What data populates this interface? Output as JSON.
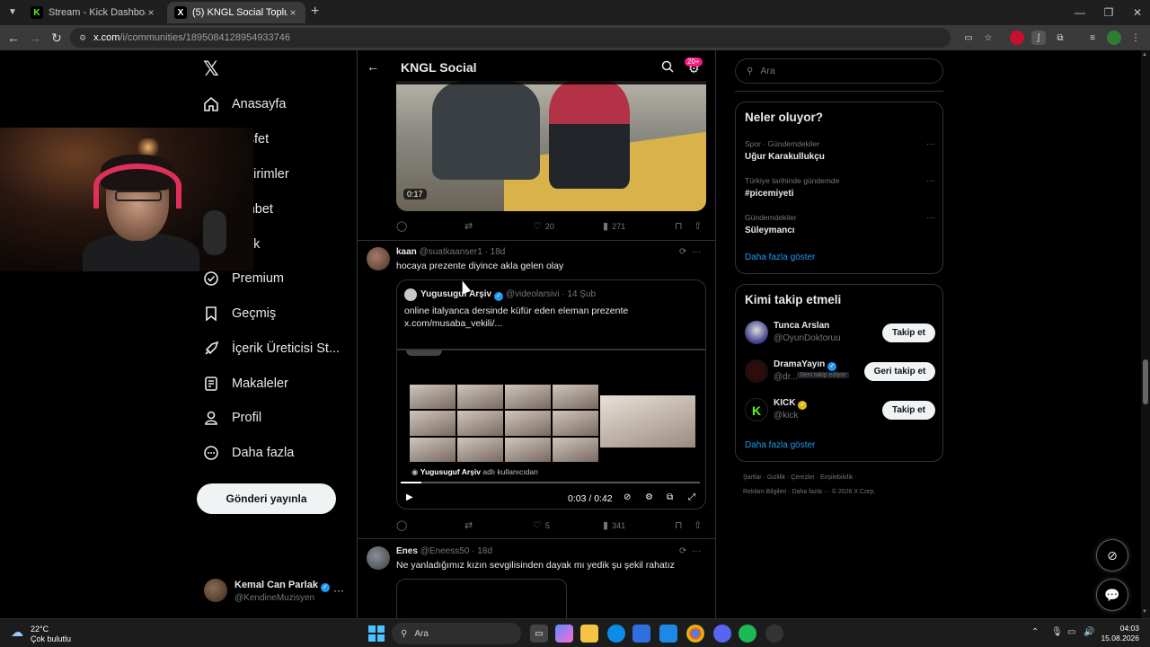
{
  "browser": {
    "tabs": [
      {
        "label": "Stream - Kick Dashboard",
        "active": false
      },
      {
        "label": "(5) KNGL Social Topluluk / X",
        "active": true
      }
    ],
    "url_host": "x.com",
    "url_path": "/i/communities/1895084128954933746"
  },
  "nav": {
    "items": [
      {
        "label": "Anasayfa",
        "icon": "home-icon"
      },
      {
        "label": "Keşfet",
        "icon": "search-icon"
      },
      {
        "label": "Bildirimler",
        "icon": "bell-icon"
      },
      {
        "label": "Sohbet",
        "icon": "chat-icon"
      },
      {
        "label": "Grok",
        "icon": "grok-icon"
      },
      {
        "label": "Premium",
        "icon": "premium-icon"
      },
      {
        "label": "Geçmiş",
        "icon": "bookmark-icon"
      },
      {
        "label": "İçerik Üreticisi St...",
        "icon": "rocket-icon"
      },
      {
        "label": "Makaleler",
        "icon": "article-icon"
      },
      {
        "label": "Profil",
        "icon": "person-icon"
      },
      {
        "label": "Daha fazla",
        "icon": "more-circle-icon"
      }
    ],
    "post_button": "Gönderi yayınla",
    "account": {
      "name": "Kemal Can Parlak",
      "handle": "@KendineMuzisyen"
    }
  },
  "header": {
    "title": "KNGL Social",
    "badge": "20+"
  },
  "feed": {
    "tweet1": {
      "duration": "0:17",
      "replies": "",
      "retweets": "",
      "likes": "20",
      "views": "271"
    },
    "tweet2": {
      "name": "kaan",
      "handle": "@suatkaanser1",
      "time": "· 18d",
      "text": "hocaya prezente diyince akla gelen olay",
      "quote": {
        "name": "Yugusuguf Arşiv",
        "handle": "@videolarsivi",
        "time": "· 14 Şub",
        "text_line1": "online italyanca dersinde küfür eden eleman prezente",
        "text_line2": "x.com/musaba_vekili/...",
        "credit_name": "Yugusuguf Arşiv",
        "credit_suffix": "adlı kullanıcıdan",
        "time_display": "0:03 / 0:42",
        "progress": 0.07
      },
      "likes": "5",
      "views": "341"
    },
    "tweet3": {
      "name": "Enes",
      "handle": "@Eneess50",
      "time": "· 18d",
      "text": "Ne yanladığımız kızın sevgilisinden dayak mı yedik şu şekil rahatız"
    }
  },
  "right": {
    "search_placeholder": "Ara",
    "trends_title": "Neler oluyor?",
    "trends": [
      {
        "context": "Spor · Gündemdekiler",
        "title": "Uğur Karakullukçu"
      },
      {
        "context": "Türkiye tarihinde gündemde",
        "title": "#picemiyeti"
      },
      {
        "context": "Gündemdekiler",
        "title": "Süleymancı"
      }
    ],
    "trends_more": "Daha fazla göster",
    "who_title": "Kimi takip etmeli",
    "who": [
      {
        "name": "Tunca Arslan",
        "handle": "@OyunDoktoruu",
        "button": "Takip et",
        "verified": ""
      },
      {
        "name": "DramaYayın",
        "handle": "@dr...",
        "tag": "Seni takip ediyor",
        "button": "Geri takip et",
        "verified": "blue"
      },
      {
        "name": "KICK",
        "handle": "@kick",
        "button": "Takip et",
        "verified": "gold"
      }
    ],
    "who_more": "Daha fazla göster",
    "footer_line1": "Şartlar  ·  Gizlilik  ·  Çerezler  ·  Erişilebilirlik  ·",
    "footer_line2": "Reklam Bilgileri  ·  Daha fazla ···  © 2026 X Corp."
  },
  "taskbar": {
    "temp": "22°C",
    "weather": "Çok bulutlu",
    "search": "Ara",
    "time": "04:03",
    "date": "15.08.2026"
  },
  "colors": {
    "accent": "#1d9bf0",
    "gold": "#e2b719",
    "badge": "#f91880",
    "background": "#000000"
  }
}
